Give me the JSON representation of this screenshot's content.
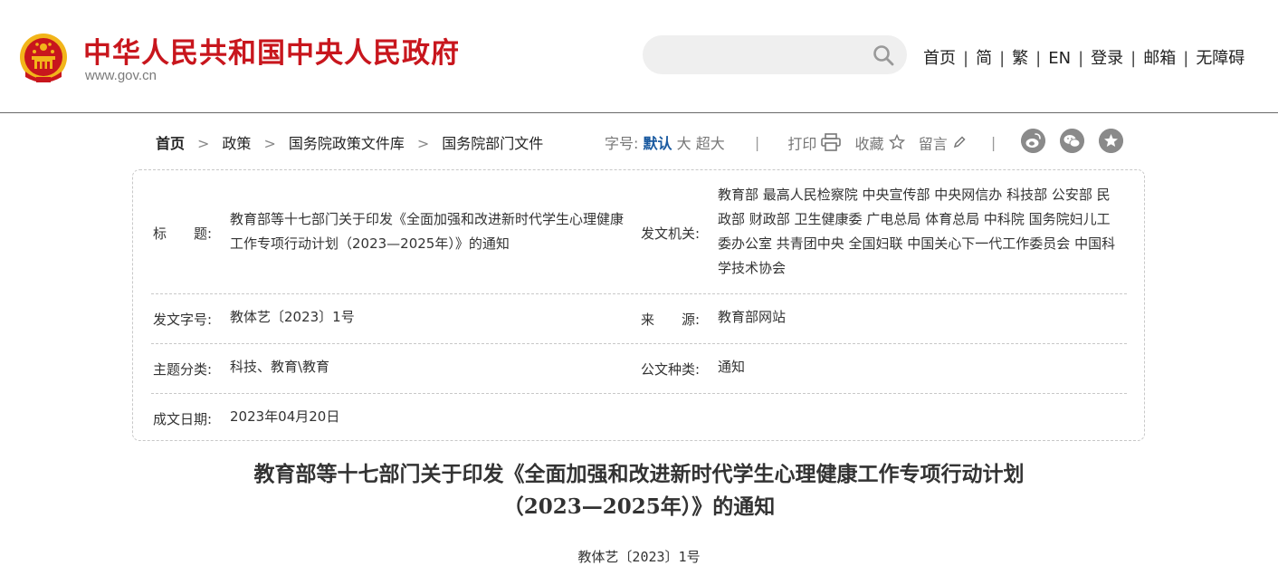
{
  "header": {
    "site_title": "中华人民共和国中央人民政府",
    "site_url": "www.gov.cn",
    "emblem_icon": "national-emblem-icon",
    "search": {
      "placeholder": "",
      "icon": "search-icon"
    },
    "nav": [
      "首页",
      "简",
      "繁",
      "EN",
      "登录",
      "邮箱",
      "无障碍"
    ]
  },
  "breadcrumb": {
    "items": [
      "首页",
      "政策",
      "国务院政策文件库",
      "国务院部门文件"
    ],
    "separator": ">"
  },
  "tools": {
    "font_size_label": "字号:",
    "font_default": "默认",
    "font_large": "大",
    "font_xlarge": "超大",
    "print_label": "打印",
    "favorite_label": "收藏",
    "comment_label": "留言",
    "divider": "|"
  },
  "share": [
    "weibo-icon",
    "wechat-icon",
    "favorite-star-icon"
  ],
  "info": {
    "title_label": "标　　题:",
    "title_value": "教育部等十七部门关于印发《全面加强和改进新时代学生心理健康工作专项行动计划（2023—2025年）》的通知",
    "issuer_label": "发文机关:",
    "issuer_value": "教育部 最高人民检察院 中央宣传部 中央网信办 科技部 公安部 民政部 财政部 卫生健康委 广电总局 体育总局 中科院 国务院妇儿工委办公室 共青团中央 全国妇联 中国关心下一代工作委员会 中国科学技术协会",
    "docno_label": "发文字号:",
    "docno_value": "教体艺〔2023〕1号",
    "source_label": "来　　源:",
    "source_value": "教育部网站",
    "topic_label": "主题分类:",
    "topic_value": "科技、教育\\教育",
    "type_label": "公文种类:",
    "type_value": "通知",
    "date_label": "成文日期:",
    "date_value": "2023年04月20日"
  },
  "article": {
    "title_line1": "教育部等十七部门关于印发《全面加强和改进新时代学生心理健康工作专项行动计划",
    "title_line2": "（2023—2025年）》的通知",
    "doc_number": "教体艺〔2023〕1号"
  },
  "colors": {
    "brand_red": "#c8161d",
    "link_blue": "#1a5aa0",
    "emblem_gold": "#f2b51a"
  }
}
